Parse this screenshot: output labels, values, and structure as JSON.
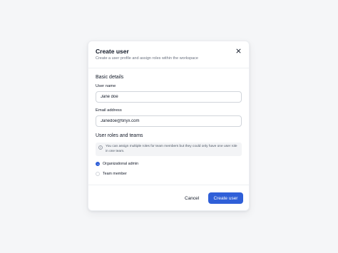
{
  "dialog": {
    "title": "Create user",
    "subtitle": "Create a user profile and assign roles within the workspace",
    "close_icon": "close-icon"
  },
  "basic_details": {
    "heading": "Basic details",
    "user_name": {
      "label": "User name",
      "value": "Jane doe"
    },
    "email": {
      "label": "Email address",
      "value": "Janedoe@tinyx.com"
    }
  },
  "roles": {
    "heading": "User roles and teams",
    "info_icon": "info-circle-icon",
    "info_text": "You can assign multiple roles for team members but they could only have one user role in one team.",
    "options": [
      {
        "label": "Organizational admin",
        "checked": true
      },
      {
        "label": "Team member",
        "checked": false
      }
    ]
  },
  "footer": {
    "cancel_label": "Cancel",
    "create_label": "Create user"
  },
  "colors": {
    "primary": "#2f5fd8",
    "background": "#f5f6f8",
    "text": "#111827",
    "muted": "#6b7280"
  }
}
